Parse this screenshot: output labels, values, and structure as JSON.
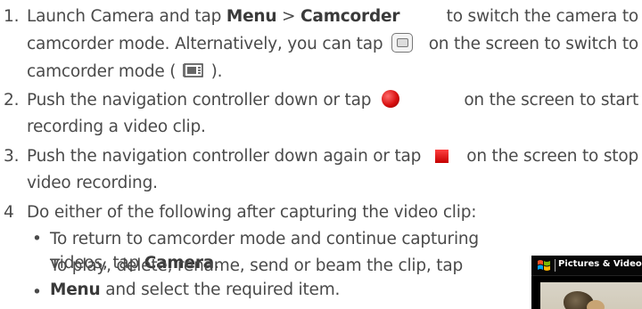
{
  "steps": [
    {
      "number": "1.",
      "line1_a": "Launch Camera and tap",
      "line1_menu": "Menu",
      "line1_sep": ">",
      "line1_camcorder": "Camcorder",
      "line1_b": "to switch the camera to",
      "line2_a": "camcorder mode. Alternatively, you can tap",
      "line2_b": "on the screen to switch to",
      "line3_a": "camcorder mode (",
      "line3_b": ")."
    },
    {
      "number": "2.",
      "line1_a": "Push the navigation controller down or tap",
      "line1_b": "on the screen to start",
      "line2": "recording a video clip."
    },
    {
      "number": "3.",
      "line1_a": "Push the navigation controller down again or tap",
      "line1_b": "on the screen to stop",
      "line2": "video recording."
    },
    {
      "number": "4",
      "line1": "Do either of the following after capturing the video clip:"
    }
  ],
  "bullets": [
    {
      "symbol": "•",
      "line1": "To return to camcorder mode and continue capturing",
      "line2_a": "videos, tap",
      "line2_bold": "Camera",
      "line2_b": "."
    },
    {
      "symbol": "•",
      "line1": "To play, delete, rename, send or beam the clip, tap",
      "line2_bold": "Menu",
      "line2_b": "and select the required item."
    }
  ],
  "icons": {
    "camera_button": "camera-switch-icon",
    "camcorder_mode": "camcorder-icon",
    "record": "record-icon",
    "stop": "stop-icon"
  },
  "device": {
    "title": "Pictures & Videos"
  },
  "colors": {
    "text": "#4a4a4a",
    "record": "#d81010",
    "stop": "#e01010",
    "device_bar": "#070707"
  }
}
